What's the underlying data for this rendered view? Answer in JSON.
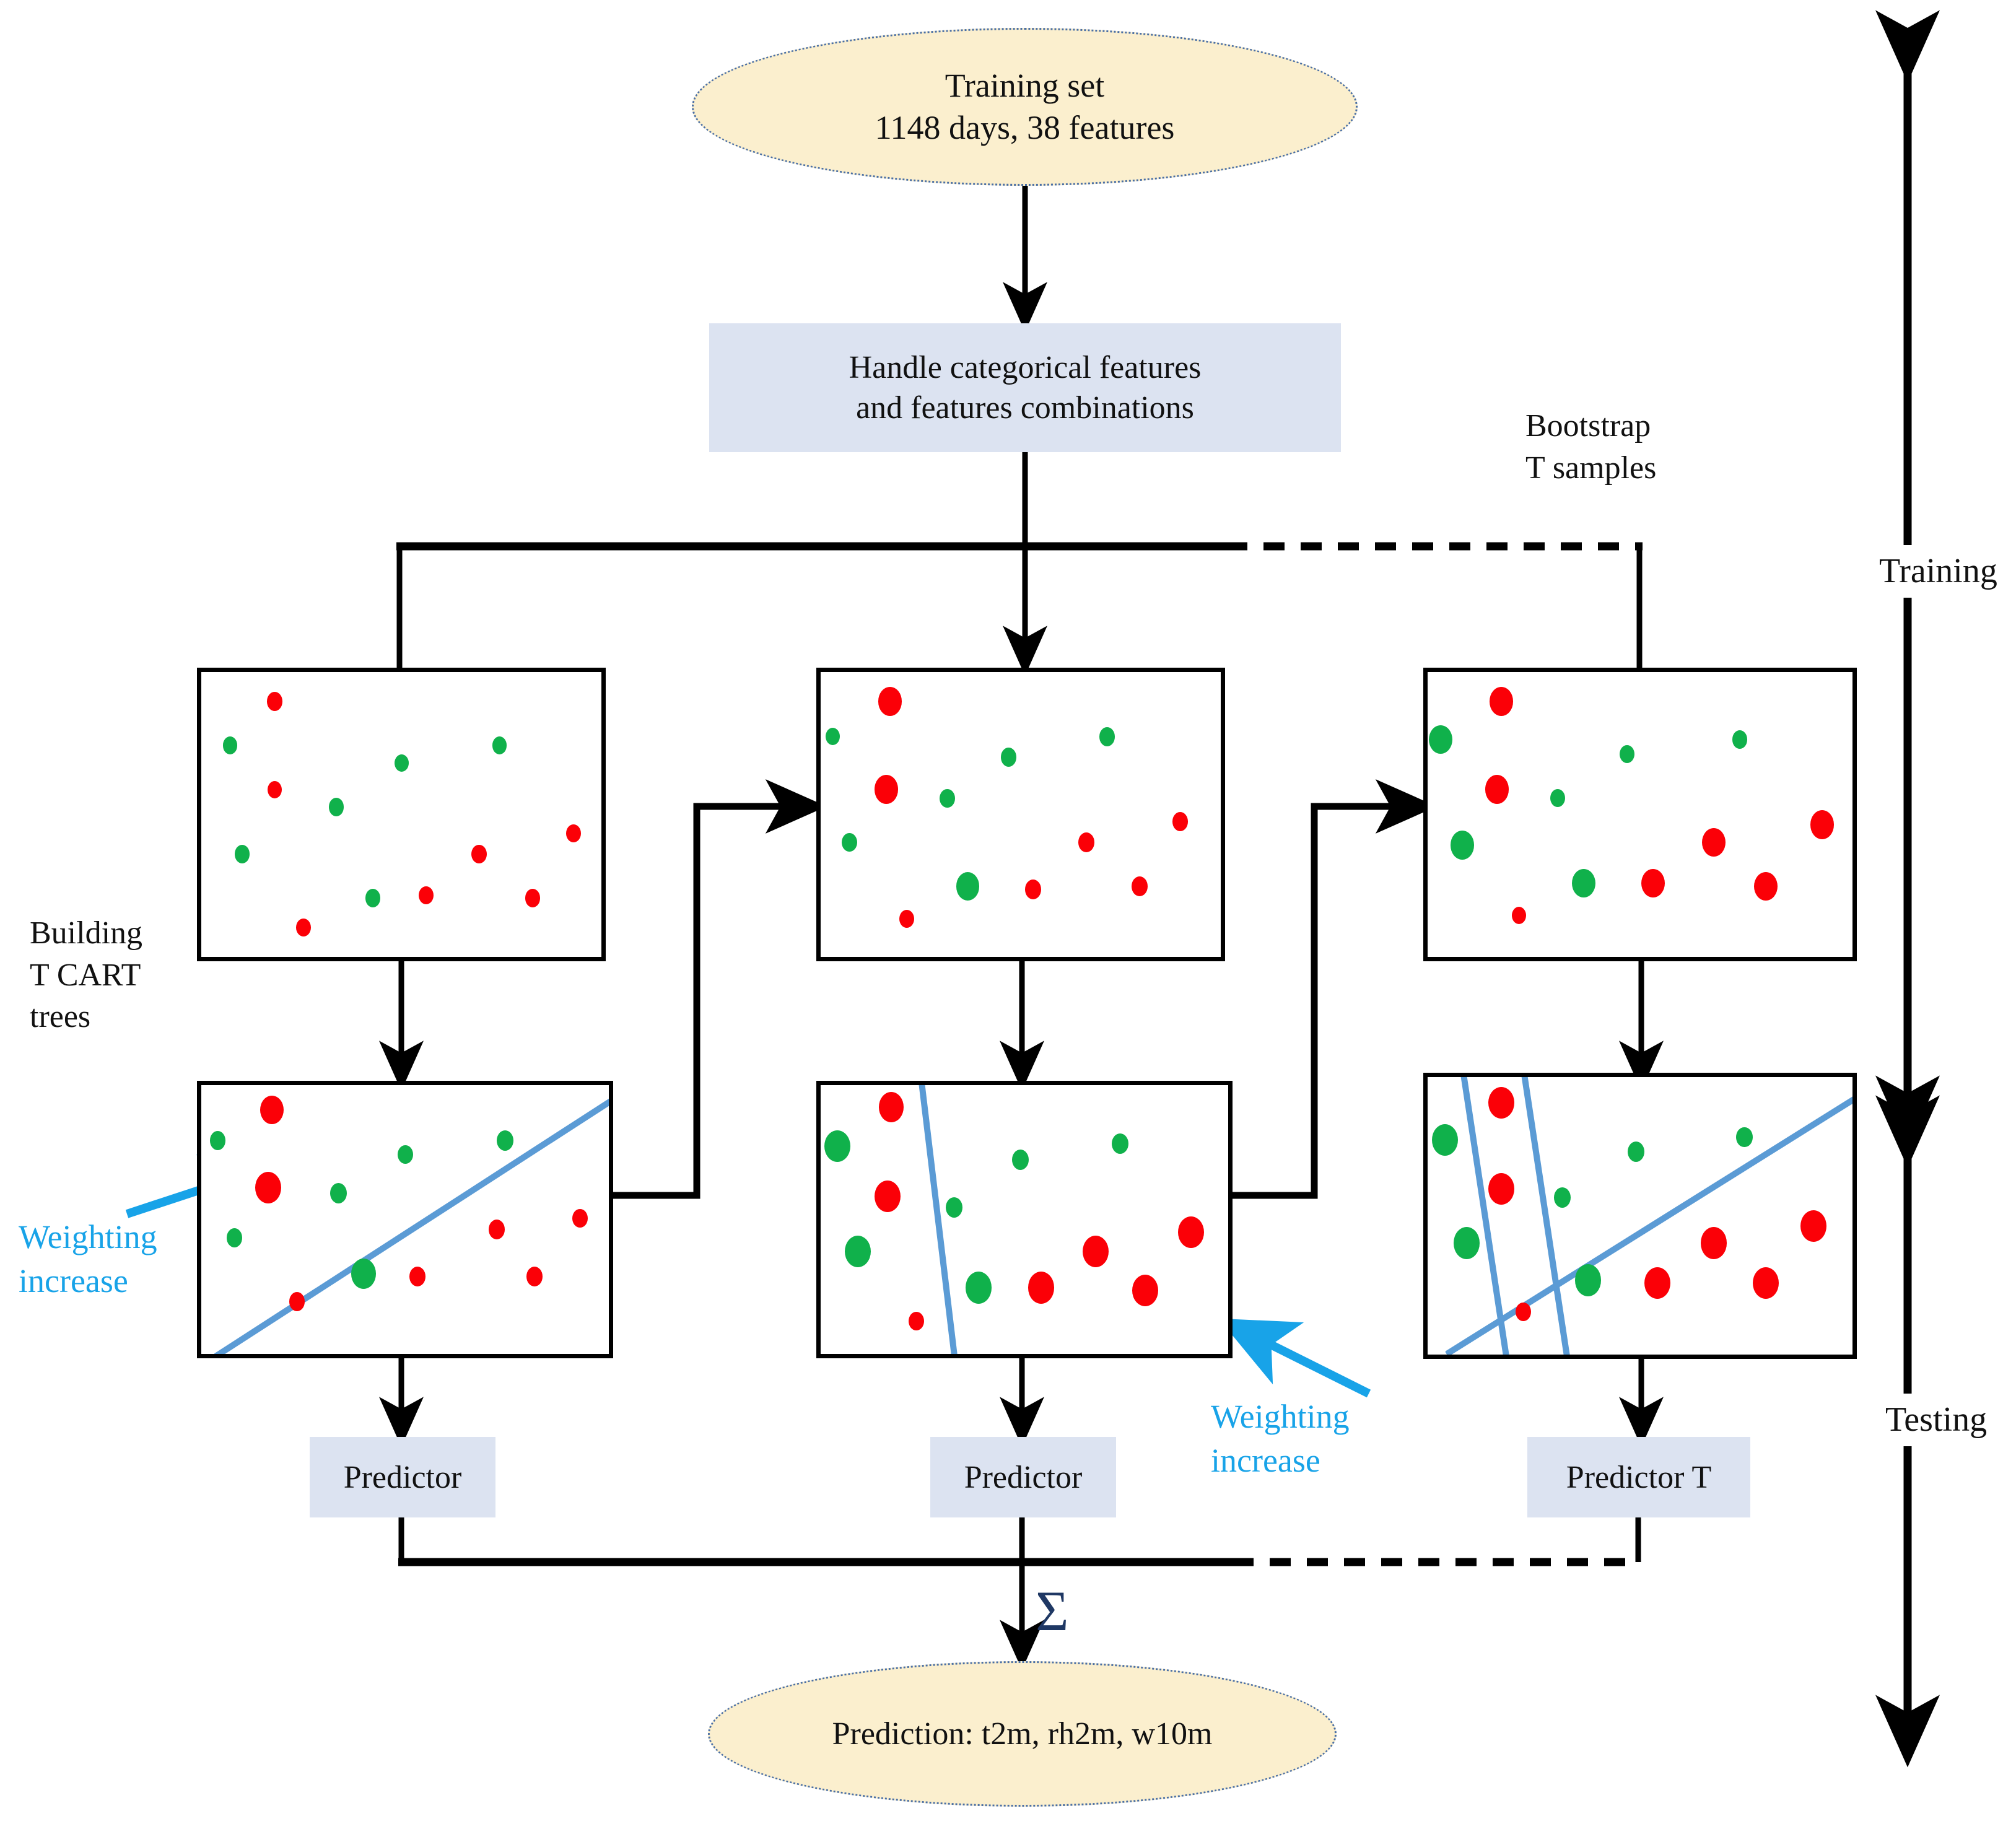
{
  "diagram": {
    "title_node": {
      "line1": "Training set",
      "line2": "1148 days, 38 features"
    },
    "preprocess_node": {
      "line1": "Handle categorical features",
      "line2": "and features combinations"
    },
    "bootstrap_label": {
      "line1": "Bootstrap",
      "line2": "T samples"
    },
    "building_label": {
      "line1": "Building",
      "line2": "T CART",
      "line3": "trees"
    },
    "phase_labels": {
      "training": "Training",
      "testing": "Testing"
    },
    "weighting_label_left": {
      "line1": "Weighting",
      "line2": "increase"
    },
    "weighting_label_right": {
      "line1": "Weighting",
      "line2": "increase"
    },
    "predictors": [
      {
        "label": "Predictor"
      },
      {
        "label": "Predictor"
      },
      {
        "label": "Predictor T"
      }
    ],
    "aggregation_symbol": "Σ",
    "output_node": {
      "text": "Prediction: t2m, rh2m, w10m"
    },
    "colors": {
      "ellipse_fill": "#FBEFCE",
      "ellipse_border": "#4A6FA5",
      "box_fill": "#DCE3F1",
      "red_point": "#FB0007",
      "green_point": "#10B14B",
      "separator_line": "#5B9BD5",
      "annotation": "#18A3E8",
      "sigma": "#1F3864",
      "connector": "#000000"
    }
  },
  "chart_data": {
    "type": "scatter",
    "title": "CART ensemble sample panels",
    "panels": [
      {
        "id": "sample-1",
        "row": "top",
        "column": 1,
        "separators": [],
        "points": [
          {
            "x": 0.18,
            "y": 0.1,
            "class": "red",
            "r": 25
          },
          {
            "x": 0.07,
            "y": 0.25,
            "class": "green",
            "r": 23
          },
          {
            "x": 0.49,
            "y": 0.31,
            "class": "green",
            "r": 23
          },
          {
            "x": 0.73,
            "y": 0.25,
            "class": "green",
            "r": 23
          },
          {
            "x": 0.18,
            "y": 0.4,
            "class": "red",
            "r": 23
          },
          {
            "x": 0.33,
            "y": 0.46,
            "class": "green",
            "r": 24
          },
          {
            "x": 0.91,
            "y": 0.55,
            "class": "red",
            "r": 24
          },
          {
            "x": 0.1,
            "y": 0.62,
            "class": "green",
            "r": 24
          },
          {
            "x": 0.68,
            "y": 0.62,
            "class": "red",
            "r": 25
          },
          {
            "x": 0.42,
            "y": 0.77,
            "class": "green",
            "r": 24
          },
          {
            "x": 0.55,
            "y": 0.76,
            "class": "red",
            "r": 24
          },
          {
            "x": 0.81,
            "y": 0.77,
            "class": "red",
            "r": 24
          },
          {
            "x": 0.25,
            "y": 0.87,
            "class": "red",
            "r": 24
          }
        ]
      },
      {
        "id": "sample-2",
        "row": "top",
        "column": 2,
        "separators": [],
        "points": [
          {
            "x": 0.17,
            "y": 0.1,
            "class": "red",
            "r": 38
          },
          {
            "x": 0.03,
            "y": 0.22,
            "class": "green",
            "r": 23
          },
          {
            "x": 0.46,
            "y": 0.29,
            "class": "green",
            "r": 25
          },
          {
            "x": 0.7,
            "y": 0.22,
            "class": "green",
            "r": 25
          },
          {
            "x": 0.16,
            "y": 0.4,
            "class": "red",
            "r": 38
          },
          {
            "x": 0.31,
            "y": 0.43,
            "class": "green",
            "r": 25
          },
          {
            "x": 0.88,
            "y": 0.51,
            "class": "red",
            "r": 25
          },
          {
            "x": 0.07,
            "y": 0.58,
            "class": "green",
            "r": 25
          },
          {
            "x": 0.65,
            "y": 0.58,
            "class": "red",
            "r": 26
          },
          {
            "x": 0.36,
            "y": 0.73,
            "class": "green",
            "r": 37
          },
          {
            "x": 0.52,
            "y": 0.74,
            "class": "red",
            "r": 26
          },
          {
            "x": 0.78,
            "y": 0.73,
            "class": "red",
            "r": 26
          },
          {
            "x": 0.21,
            "y": 0.84,
            "class": "red",
            "r": 24
          }
        ]
      },
      {
        "id": "sample-T",
        "row": "top",
        "column": 3,
        "separators": [],
        "points": [
          {
            "x": 0.17,
            "y": 0.1,
            "class": "red",
            "r": 38
          },
          {
            "x": 0.03,
            "y": 0.23,
            "class": "green",
            "r": 38
          },
          {
            "x": 0.46,
            "y": 0.28,
            "class": "green",
            "r": 24
          },
          {
            "x": 0.72,
            "y": 0.23,
            "class": "green",
            "r": 24
          },
          {
            "x": 0.16,
            "y": 0.4,
            "class": "red",
            "r": 38
          },
          {
            "x": 0.3,
            "y": 0.43,
            "class": "green",
            "r": 24
          },
          {
            "x": 0.91,
            "y": 0.52,
            "class": "red",
            "r": 38
          },
          {
            "x": 0.08,
            "y": 0.59,
            "class": "green",
            "r": 38
          },
          {
            "x": 0.66,
            "y": 0.58,
            "class": "red",
            "r": 38
          },
          {
            "x": 0.36,
            "y": 0.72,
            "class": "green",
            "r": 38
          },
          {
            "x": 0.52,
            "y": 0.72,
            "class": "red",
            "r": 38
          },
          {
            "x": 0.78,
            "y": 0.73,
            "class": "red",
            "r": 38
          },
          {
            "x": 0.21,
            "y": 0.83,
            "class": "red",
            "r": 23
          }
        ]
      },
      {
        "id": "tree-1",
        "row": "bottom",
        "column": 1,
        "separators": [
          {
            "x1": 0.03,
            "y1": 0.98,
            "x2": 1.0,
            "y2": 0.04,
            "kind": "diagonal"
          }
        ],
        "points": [
          {
            "x": 0.17,
            "y": 0.09,
            "class": "red",
            "r": 38
          },
          {
            "x": 0.04,
            "y": 0.2,
            "class": "green",
            "r": 25
          },
          {
            "x": 0.49,
            "y": 0.25,
            "class": "green",
            "r": 25
          },
          {
            "x": 0.73,
            "y": 0.2,
            "class": "green",
            "r": 27
          },
          {
            "x": 0.16,
            "y": 0.37,
            "class": "red",
            "r": 42
          },
          {
            "x": 0.33,
            "y": 0.39,
            "class": "green",
            "r": 27
          },
          {
            "x": 0.91,
            "y": 0.48,
            "class": "red",
            "r": 25
          },
          {
            "x": 0.08,
            "y": 0.55,
            "class": "green",
            "r": 25
          },
          {
            "x": 0.71,
            "y": 0.52,
            "class": "red",
            "r": 26
          },
          {
            "x": 0.39,
            "y": 0.68,
            "class": "green",
            "r": 40
          },
          {
            "x": 0.52,
            "y": 0.69,
            "class": "red",
            "r": 26
          },
          {
            "x": 0.8,
            "y": 0.69,
            "class": "red",
            "r": 26
          },
          {
            "x": 0.23,
            "y": 0.78,
            "class": "red",
            "r": 25
          }
        ]
      },
      {
        "id": "tree-2",
        "row": "bottom",
        "column": 2,
        "separators": [
          {
            "x1": 0.25,
            "y1": 0.0,
            "x2": 0.33,
            "y2": 1.0,
            "kind": "vertical"
          }
        ],
        "points": [
          {
            "x": 0.17,
            "y": 0.08,
            "class": "red",
            "r": 40
          },
          {
            "x": 0.04,
            "y": 0.22,
            "class": "green",
            "r": 42
          },
          {
            "x": 0.48,
            "y": 0.27,
            "class": "green",
            "r": 27
          },
          {
            "x": 0.72,
            "y": 0.21,
            "class": "green",
            "r": 27
          },
          {
            "x": 0.16,
            "y": 0.4,
            "class": "red",
            "r": 42
          },
          {
            "x": 0.32,
            "y": 0.44,
            "class": "green",
            "r": 27
          },
          {
            "x": 0.89,
            "y": 0.53,
            "class": "red",
            "r": 42
          },
          {
            "x": 0.09,
            "y": 0.6,
            "class": "green",
            "r": 42
          },
          {
            "x": 0.66,
            "y": 0.6,
            "class": "red",
            "r": 42
          },
          {
            "x": 0.38,
            "y": 0.73,
            "class": "green",
            "r": 42
          },
          {
            "x": 0.53,
            "y": 0.73,
            "class": "red",
            "r": 42
          },
          {
            "x": 0.78,
            "y": 0.74,
            "class": "red",
            "r": 42
          },
          {
            "x": 0.23,
            "y": 0.85,
            "class": "red",
            "r": 25
          }
        ]
      },
      {
        "id": "tree-T",
        "row": "bottom",
        "column": 3,
        "separators": [
          {
            "x1": 0.09,
            "y1": 0.0,
            "x2": 0.19,
            "y2": 1.0,
            "kind": "vertical"
          },
          {
            "x1": 0.23,
            "y1": 0.0,
            "x2": 0.33,
            "y2": 1.0,
            "kind": "vertical"
          },
          {
            "x1": 0.04,
            "y1": 0.97,
            "x2": 1.0,
            "y2": 0.06,
            "kind": "diagonal"
          }
        ],
        "points": [
          {
            "x": 0.17,
            "y": 0.09,
            "class": "red",
            "r": 42
          },
          {
            "x": 0.04,
            "y": 0.22,
            "class": "green",
            "r": 42
          },
          {
            "x": 0.48,
            "y": 0.26,
            "class": "green",
            "r": 27
          },
          {
            "x": 0.73,
            "y": 0.21,
            "class": "green",
            "r": 27
          },
          {
            "x": 0.17,
            "y": 0.39,
            "class": "red",
            "r": 42
          },
          {
            "x": 0.31,
            "y": 0.42,
            "class": "green",
            "r": 27
          },
          {
            "x": 0.89,
            "y": 0.52,
            "class": "red",
            "r": 42
          },
          {
            "x": 0.09,
            "y": 0.58,
            "class": "green",
            "r": 42
          },
          {
            "x": 0.66,
            "y": 0.58,
            "class": "red",
            "r": 42
          },
          {
            "x": 0.37,
            "y": 0.71,
            "class": "green",
            "r": 42
          },
          {
            "x": 0.53,
            "y": 0.72,
            "class": "red",
            "r": 42
          },
          {
            "x": 0.78,
            "y": 0.72,
            "class": "red",
            "r": 42
          },
          {
            "x": 0.22,
            "y": 0.82,
            "class": "red",
            "r": 25
          }
        ]
      }
    ]
  }
}
